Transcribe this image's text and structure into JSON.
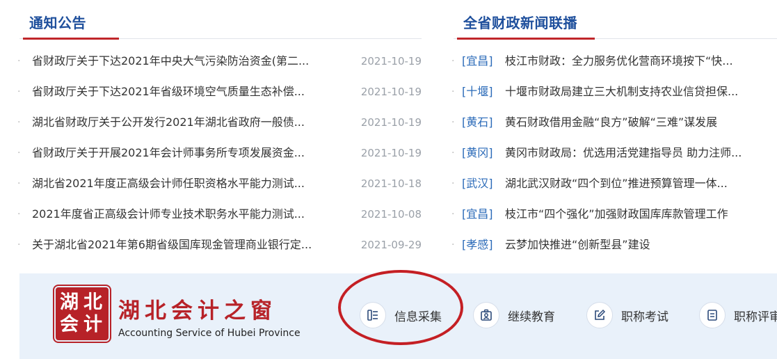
{
  "notices": {
    "title": "通知公告",
    "items": [
      {
        "title": "省财政厅关于下达2021年中央大气污染防治资金(第二...",
        "date": "2021-10-19"
      },
      {
        "title": "省财政厅关于下达2021年省级环境空气质量生态补偿...",
        "date": "2021-10-19"
      },
      {
        "title": "湖北省财政厅关于公开发行2021年湖北省政府一般债...",
        "date": "2021-10-19"
      },
      {
        "title": "省财政厅关于开展2021年会计师事务所专项发展资金...",
        "date": "2021-10-19"
      },
      {
        "title": "湖北省2021年度正高级会计师任职资格水平能力测试...",
        "date": "2021-10-18"
      },
      {
        "title": "2021年度省正高级会计师专业技术职务水平能力测试...",
        "date": "2021-10-08"
      },
      {
        "title": "关于湖北省2021年第6期省级国库现金管理商业银行定...",
        "date": "2021-09-29"
      }
    ]
  },
  "news": {
    "title": "全省财政新闻联播",
    "items": [
      {
        "region": "[宜昌]",
        "title": "枝江市财政：全力服务优化营商环境按下“快..."
      },
      {
        "region": "[十堰]",
        "title": "十堰市财政局建立三大机制支持农业信贷担保..."
      },
      {
        "region": "[黄石]",
        "title": "黄石财政借用金融“良方”破解“三难”谋发展"
      },
      {
        "region": "[黄冈]",
        "title": "黄冈市财政局：优选用活党建指导员 助力注师..."
      },
      {
        "region": "[武汉]",
        "title": "湖北武汉财政“四个到位”推进预算管理一体..."
      },
      {
        "region": "[宜昌]",
        "title": "枝江市“四个强化”加强财政国库库款管理工作"
      },
      {
        "region": "[孝感]",
        "title": "云梦加快推进“创新型县”建设"
      }
    ]
  },
  "portal": {
    "seal": [
      "湖",
      "北",
      "会",
      "计"
    ],
    "name": "湖北会计之窗",
    "subtitle": "Accounting Service of Hubei Province",
    "nav": [
      {
        "label": "信息采集",
        "icon": "info-collect-icon"
      },
      {
        "label": "继续教育",
        "icon": "education-icon"
      },
      {
        "label": "职称考试",
        "icon": "exam-edit-icon"
      },
      {
        "label": "职称评审",
        "icon": "review-doc-icon"
      }
    ]
  },
  "colors": {
    "brand_blue": "#1e4f9c",
    "accent_red": "#c0262a",
    "link_blue": "#2a6ab8",
    "band_bg": "#e9f1fa"
  }
}
